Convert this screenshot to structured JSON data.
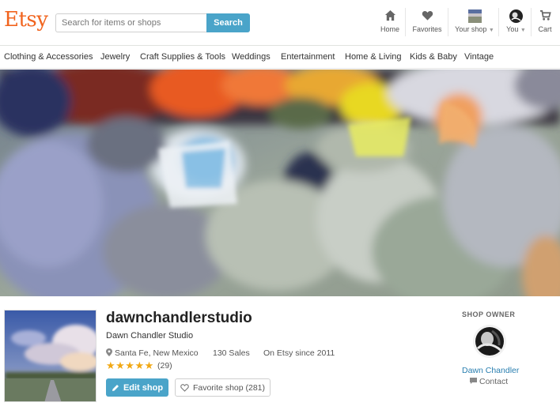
{
  "header": {
    "logo": "Etsy",
    "search_placeholder": "Search for items or shops",
    "search_button": "Search",
    "nav": {
      "home": "Home",
      "favorites": "Favorites",
      "your_shop": "Your shop",
      "you": "You",
      "cart": "Cart"
    }
  },
  "categories": [
    "Clothing & Accessories",
    "Jewelry",
    "Craft Supplies & Tools",
    "Weddings",
    "Entertainment",
    "Home & Living",
    "Kids & Baby",
    "Vintage"
  ],
  "shop": {
    "name": "dawnchandlerstudio",
    "title": "Dawn Chandler Studio",
    "location": "Santa Fe, New Mexico",
    "sales": "130 Sales",
    "since": "On Etsy since 2011",
    "rating_stars": 5,
    "stars_text": "★★★★★",
    "reviews": "(29)",
    "edit_button": "Edit shop",
    "favorite_button": "Favorite shop (281)"
  },
  "owner": {
    "label": "SHOP OWNER",
    "name": "Dawn Chandler",
    "contact": "Contact"
  },
  "colors": {
    "brand": "#f1641e",
    "accent": "#4aa4c9",
    "star": "#f1a814",
    "link": "#2a7fb0"
  }
}
